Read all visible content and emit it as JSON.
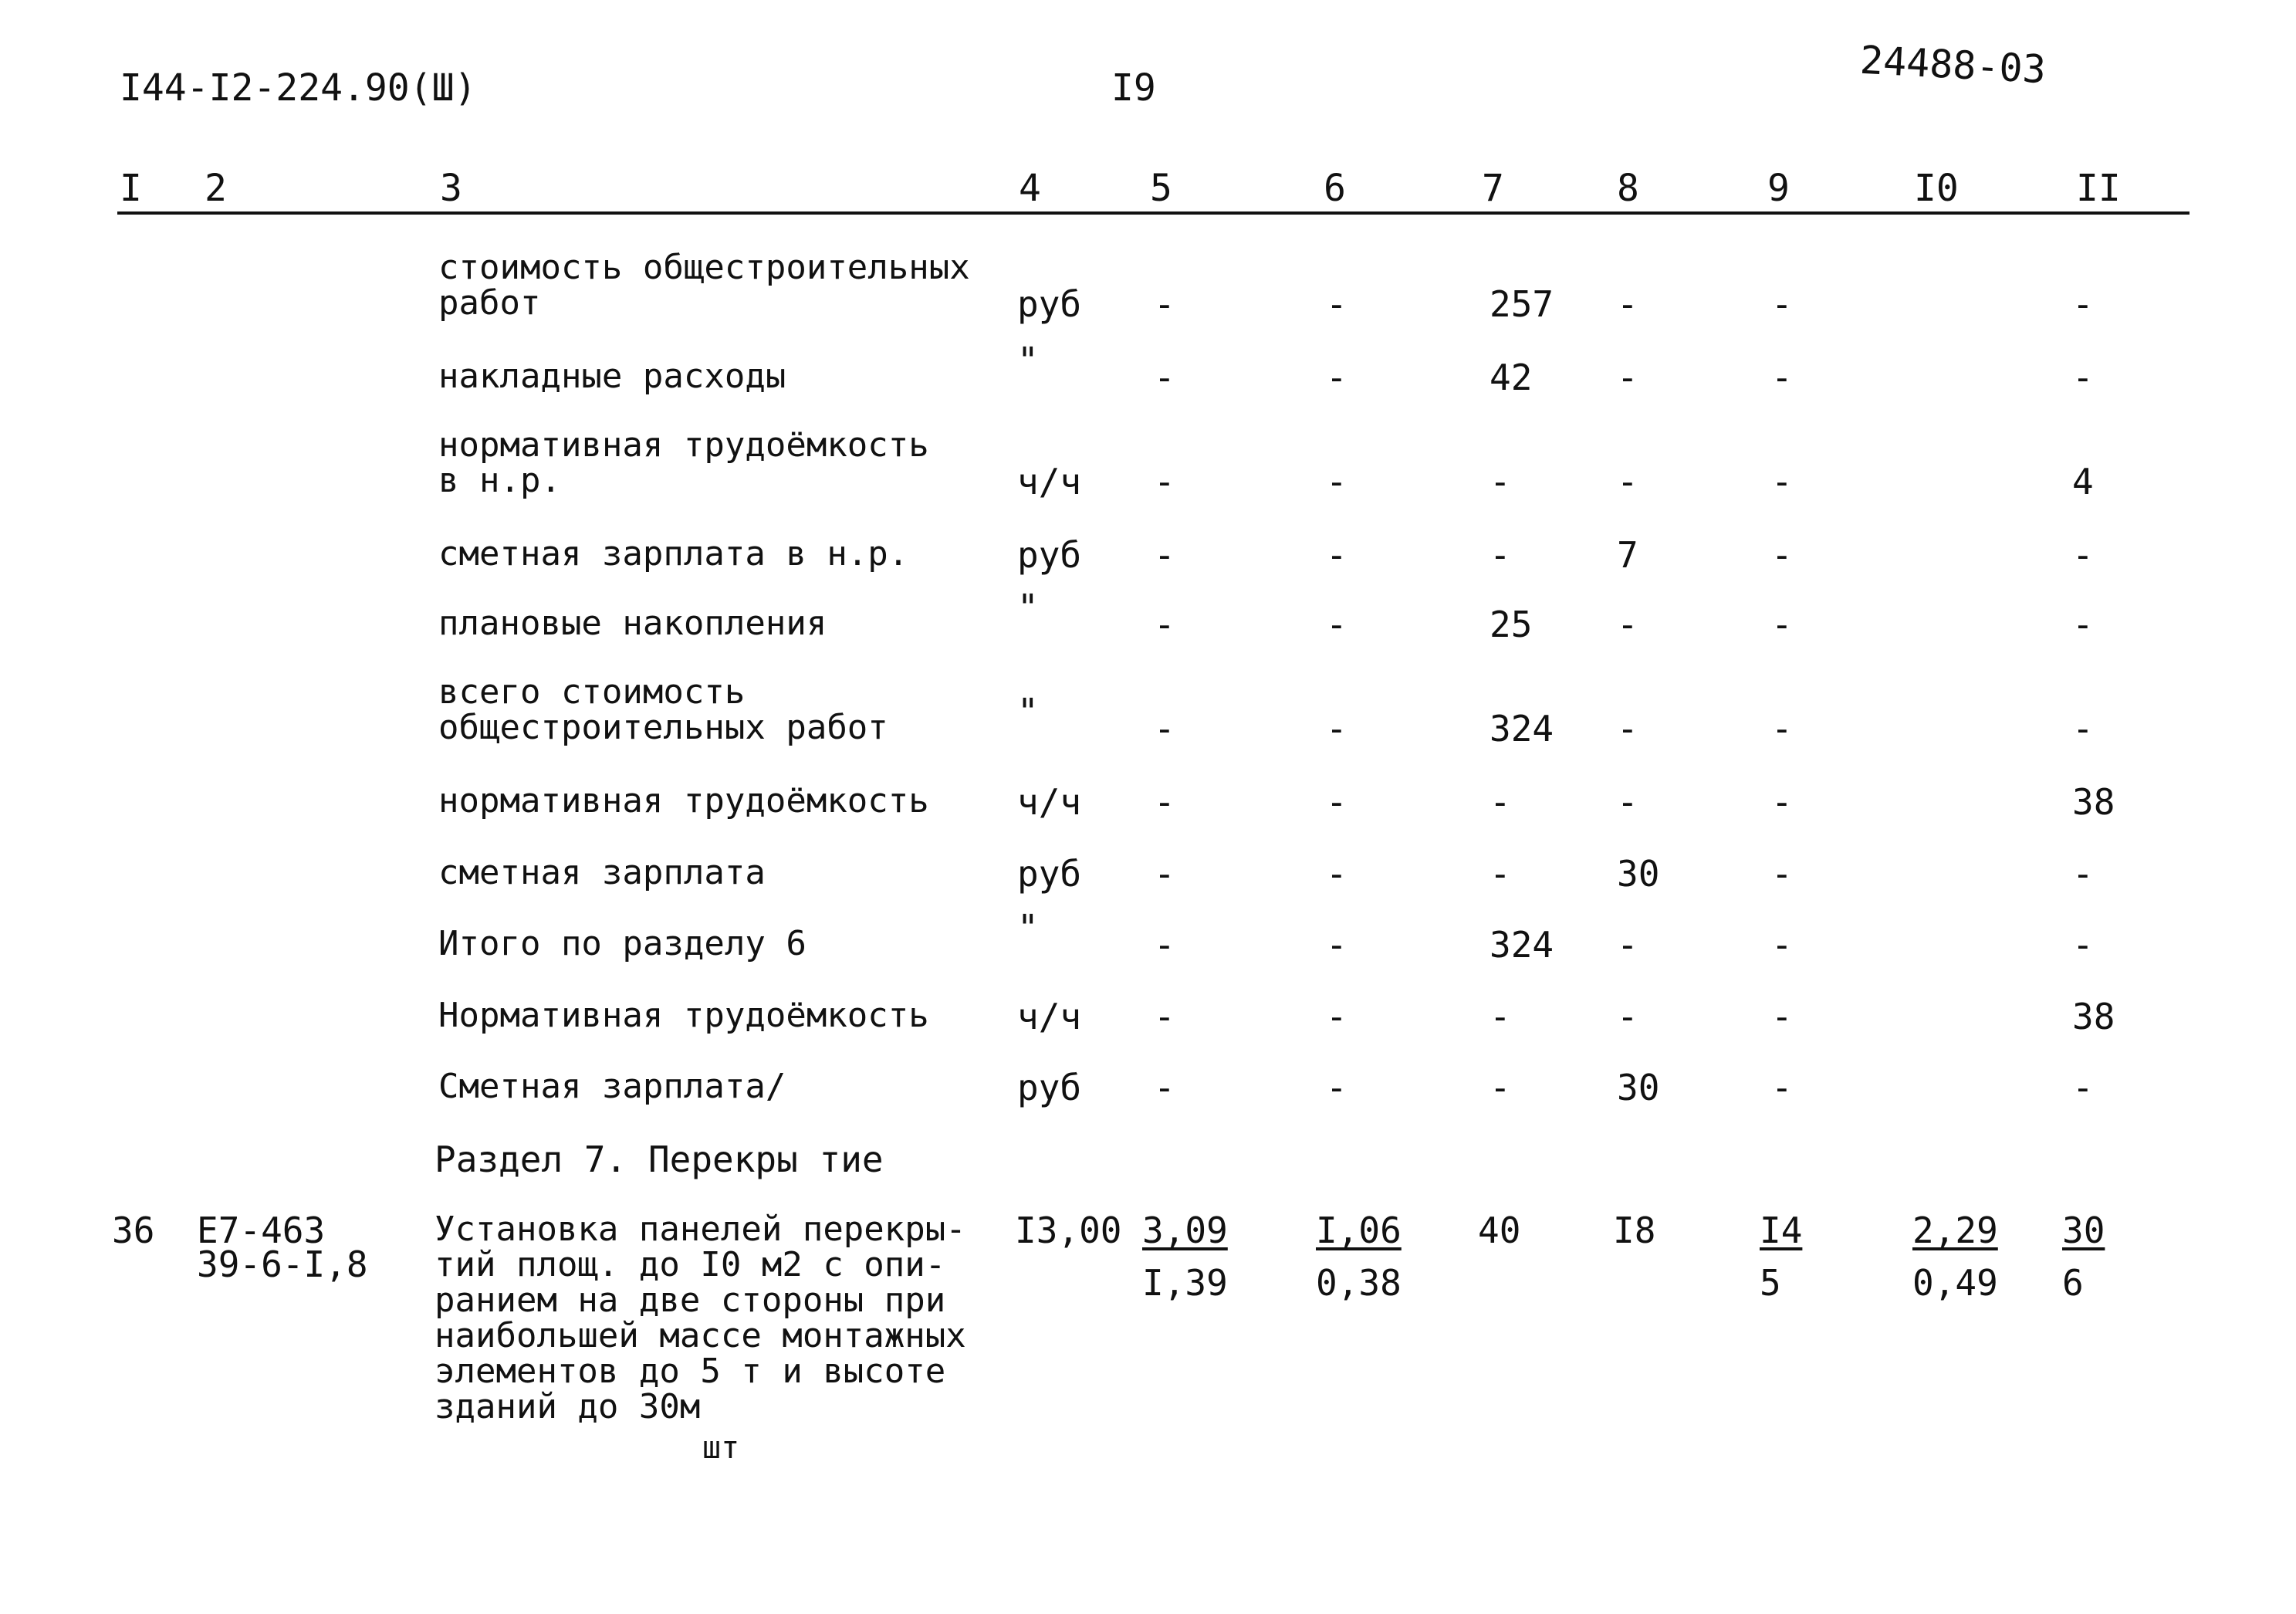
{
  "page": {
    "doc_code": "I44-I2-224.90(Ш)",
    "page_number": "I9",
    "stamp": "24488-03"
  },
  "columns": [
    "I",
    "2",
    "3",
    "4",
    "5",
    "6",
    "7",
    "8",
    "9",
    "I0",
    "II"
  ],
  "rows": [
    {
      "desc": "стоимость общестроительных\nработ",
      "unit": "руб",
      "c5": "-",
      "c6": "-",
      "c7": "257",
      "c8": "-",
      "c9": "-",
      "c10": "",
      "c11": "-"
    },
    {
      "desc": "накладные расходы",
      "unit": "\"",
      "c5": "-",
      "c6": "-",
      "c7": "42",
      "c8": "-",
      "c9": "-",
      "c10": "",
      "c11": "-"
    },
    {
      "desc": "нормативная трудоёмкость\nв н.р.",
      "unit": "ч/ч",
      "c5": "-",
      "c6": "-",
      "c7": "-",
      "c8": "-",
      "c9": "-",
      "c10": "",
      "c11": "4"
    },
    {
      "desc": "сметная зарплата в н.р.",
      "unit": "руб",
      "c5": "-",
      "c6": "-",
      "c7": "-",
      "c8": "7",
      "c9": "-",
      "c10": "",
      "c11": "-"
    },
    {
      "desc": "плановые накопления",
      "unit": "\"",
      "c5": "-",
      "c6": "-",
      "c7": "25",
      "c8": "-",
      "c9": "-",
      "c10": "",
      "c11": "-"
    },
    {
      "desc": "всего стоимость\nобщестроительных работ",
      "unit": "\"",
      "c5": "-",
      "c6": "-",
      "c7": "324",
      "c8": "-",
      "c9": "-",
      "c10": "",
      "c11": "-"
    },
    {
      "desc": "нормативная трудоёмкость",
      "unit": "ч/ч",
      "c5": "-",
      "c6": "-",
      "c7": "-",
      "c8": "-",
      "c9": "-",
      "c10": "",
      "c11": "38"
    },
    {
      "desc": "сметная зарплата",
      "unit": "руб",
      "c5": "-",
      "c6": "-",
      "c7": "-",
      "c8": "30",
      "c9": "-",
      "c10": "",
      "c11": "-"
    },
    {
      "desc": "Итого по разделу 6",
      "unit": "\"",
      "c5": "-",
      "c6": "-",
      "c7": "324",
      "c8": "-",
      "c9": "-",
      "c10": "",
      "c11": "-"
    },
    {
      "desc": "Нормативная трудоёмкость",
      "unit": "ч/ч",
      "c5": "-",
      "c6": "-",
      "c7": "-",
      "c8": "-",
      "c9": "-",
      "c10": "",
      "c11": "38"
    },
    {
      "desc": "Сметная зарплата/",
      "unit": "руб",
      "c5": "-",
      "c6": "-",
      "c7": "-",
      "c8": "30",
      "c9": "-",
      "c10": "",
      "c11": "-"
    }
  ],
  "section7": {
    "title": "Раздел 7. Перекры тие"
  },
  "item36": {
    "num": "36",
    "code1": "Е7-463",
    "code2": "39-6-I,8",
    "desc": "Установка панелей перекры-\nтий площ. до I0 м2 с опи-\nранием на две стороны при\nнаибольшей массе монтажных\nэлементов до 5 т и высоте\nзданий до 30м",
    "unit": "шт",
    "qty": "I3,00",
    "c5_top": "3,09",
    "c5_bot": "I,39",
    "c6_top": "I,06",
    "c6_bot": "0,38",
    "c7": "40",
    "c8": "I8",
    "c9_top": "I4",
    "c9_bot": "5",
    "c10_top": "2,29",
    "c10_bot": "0,49",
    "c11_top": "30",
    "c11_bot": "6"
  }
}
